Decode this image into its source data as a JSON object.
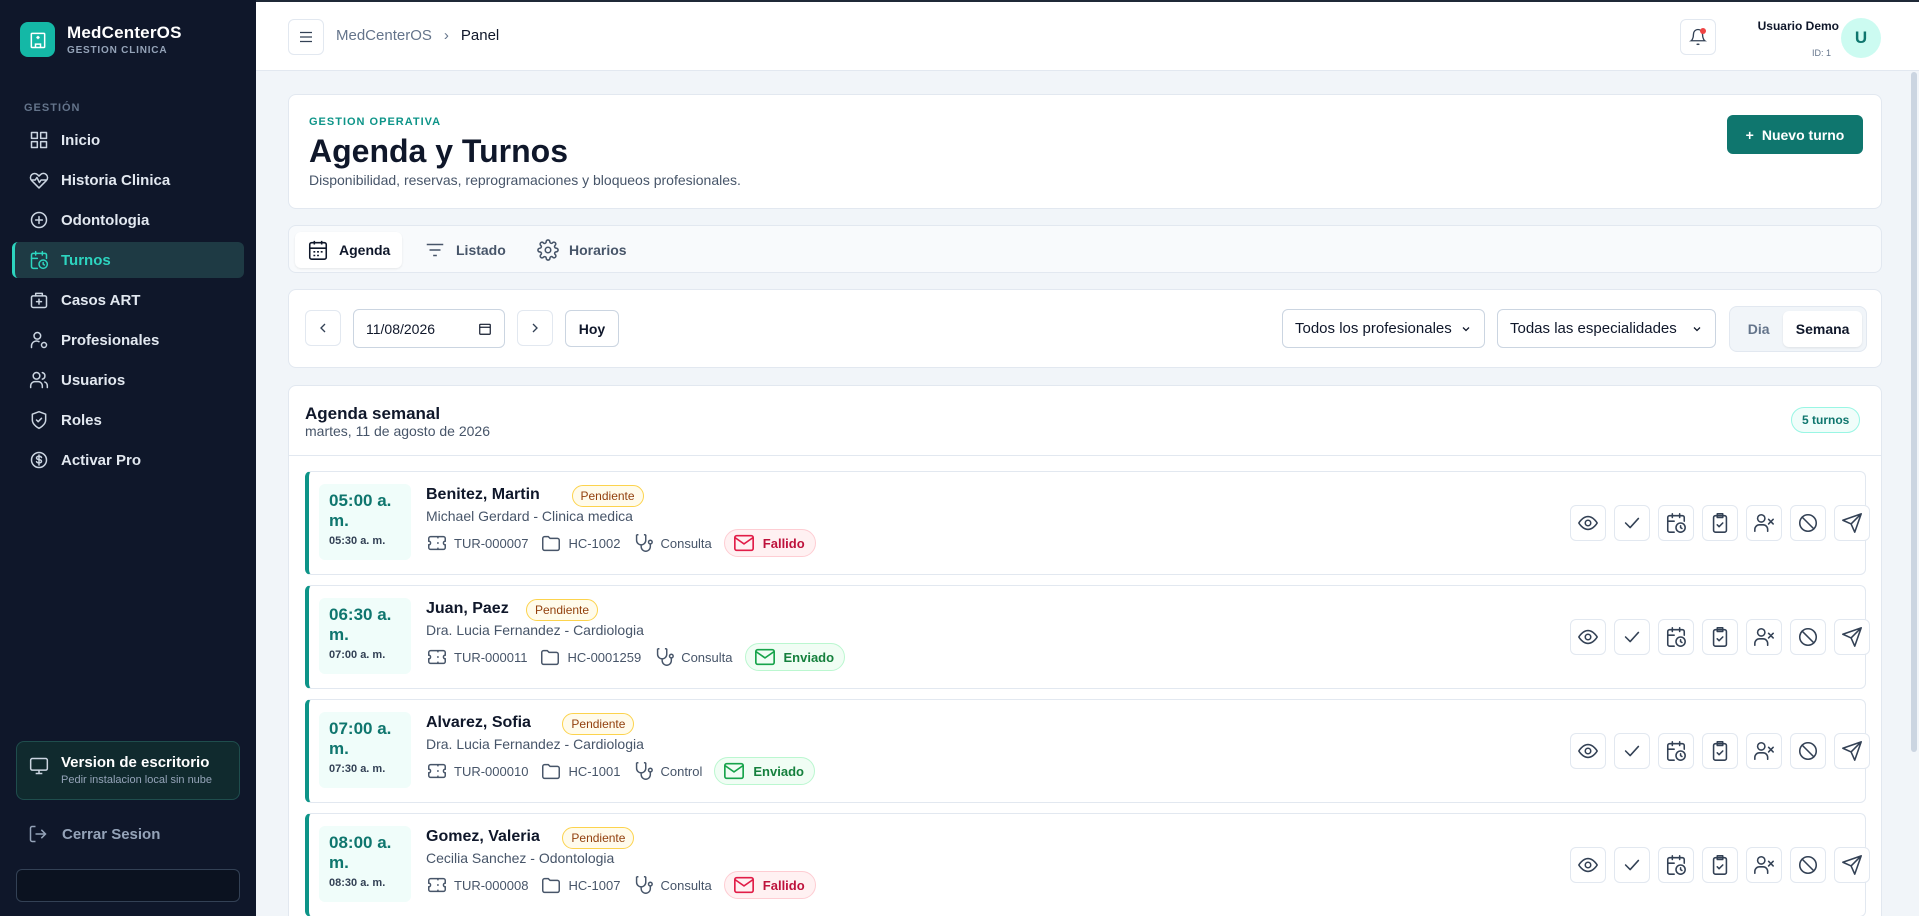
{
  "brand": {
    "title": "MedCenterOS",
    "subtitle": "GESTION CLINICA"
  },
  "sidebar": {
    "section": "GESTIÓN",
    "items": [
      {
        "label": "Inicio",
        "icon": "grid-icon"
      },
      {
        "label": "Historia Clinica",
        "icon": "heart-pulse-icon"
      },
      {
        "label": "Odontologia",
        "icon": "plus-circle-icon"
      },
      {
        "label": "Turnos",
        "icon": "calendar-clock-icon",
        "active": true
      },
      {
        "label": "Casos ART",
        "icon": "briefcase-medical-icon"
      },
      {
        "label": "Profesionales",
        "icon": "user-cog-icon"
      },
      {
        "label": "Usuarios",
        "icon": "users-icon"
      },
      {
        "label": "Roles",
        "icon": "shield-icon"
      },
      {
        "label": "Activar Pro",
        "icon": "dollar-circle-icon"
      }
    ],
    "desktop_card": {
      "title": "Version de escritorio",
      "subtitle": "Pedir instalacion local sin nube"
    },
    "logout": "Cerrar Sesion"
  },
  "topbar": {
    "breadcrumb": [
      "MedCenterOS",
      "Panel"
    ],
    "user_name": "Usuario Demo",
    "user_id": "ID: 1",
    "avatar_letter": "U"
  },
  "header": {
    "eyebrow": "GESTION OPERATIVA",
    "title": "Agenda y Turnos",
    "subtitle": "Disponibilidad, reservas, reprogramaciones y bloqueos profesionales.",
    "new_button": "Nuevo turno"
  },
  "tabs": [
    {
      "label": "Agenda",
      "active": true
    },
    {
      "label": "Listado"
    },
    {
      "label": "Horarios"
    }
  ],
  "filters": {
    "date": "11/08/2026",
    "today": "Hoy",
    "professional": "Todos los profesionales",
    "specialty": "Todas las especialidades",
    "view_day": "Dia",
    "view_week": "Semana",
    "selected_view": "Semana"
  },
  "agenda": {
    "title": "Agenda semanal",
    "date": "martes, 11 de agosto de 2026",
    "count": "5 turnos",
    "appointments": [
      {
        "start": "05:00 a. m.",
        "end": "05:30 a. m.",
        "patient": "Benitez, Martin",
        "status": "Pendiente",
        "doctor": "Michael Gerdard - Clinica medica",
        "ticket": "TUR-000007",
        "record": "HC-1002",
        "type": "Consulta",
        "mail": "Fallido",
        "mail_state": "fail"
      },
      {
        "start": "06:30 a. m.",
        "end": "07:00 a. m.",
        "patient": "Juan, Paez",
        "status": "Pendiente",
        "doctor": "Dra. Lucia Fernandez - Cardiologia",
        "ticket": "TUR-000011",
        "record": "HC-0001259",
        "type": "Consulta",
        "mail": "Enviado",
        "mail_state": "ok"
      },
      {
        "start": "07:00 a. m.",
        "end": "07:30 a. m.",
        "patient": "Alvarez, Sofia",
        "status": "Pendiente",
        "doctor": "Dra. Lucia Fernandez - Cardiologia",
        "ticket": "TUR-000010",
        "record": "HC-1001",
        "type": "Control",
        "mail": "Enviado",
        "mail_state": "ok"
      },
      {
        "start": "08:00 a. m.",
        "end": "08:30 a. m.",
        "patient": "Gomez, Valeria",
        "status": "Pendiente",
        "doctor": "Cecilia Sanchez - Odontologia",
        "ticket": "TUR-000008",
        "record": "HC-1007",
        "type": "Consulta",
        "mail": "Fallido",
        "mail_state": "fail"
      }
    ]
  },
  "colors": {
    "accent": "#0d9488",
    "sidebar_bg": "#0f172a",
    "primary_button": "#0f766e"
  }
}
